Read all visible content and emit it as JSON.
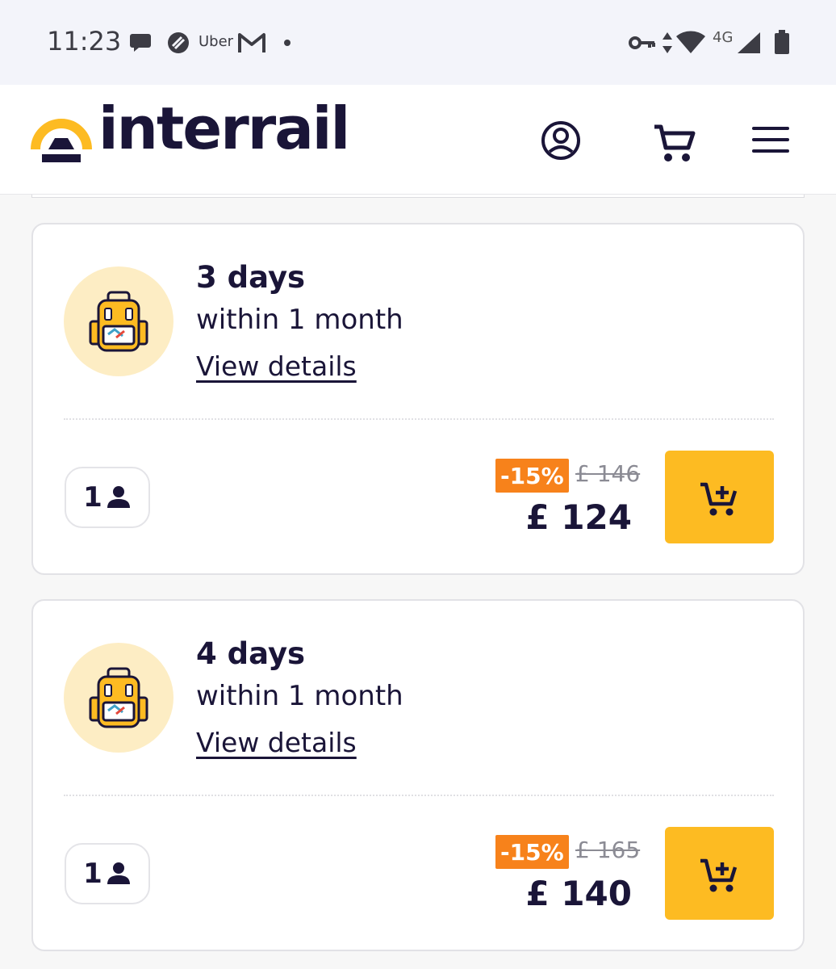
{
  "status_bar": {
    "time": "11:23",
    "app_label": "Uber",
    "network": "4G",
    "icons": [
      "messages-icon",
      "app-icon",
      "gmail-icon",
      "dot-icon",
      "vpn-key-icon",
      "data-arrows-icon",
      "wifi-icon",
      "signal-icon",
      "battery-icon"
    ]
  },
  "header": {
    "brand": "interrail",
    "brand_color": "#1a1538",
    "accent_color": "#fdbb22",
    "icons": [
      "account-icon",
      "cart-icon",
      "menu-icon"
    ]
  },
  "passes": [
    {
      "title": "3 days",
      "subtitle": "within 1 month",
      "link": "View details",
      "travellers": "1",
      "discount": "-15%",
      "old_price": "£ 146",
      "price": "£ 124"
    },
    {
      "title": "4 days",
      "subtitle": "within 1 month",
      "link": "View details",
      "travellers": "1",
      "discount": "-15%",
      "old_price": "£ 165",
      "price": "£ 140"
    }
  ],
  "colors": {
    "discount_badge": "#f7821b",
    "cart_button": "#fdbb22",
    "icon_bg": "#fdedc4"
  }
}
